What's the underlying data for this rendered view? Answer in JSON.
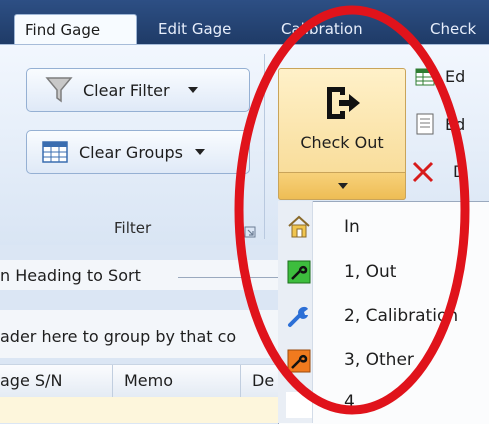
{
  "tabs": [
    {
      "label": "Find Gage",
      "active": true
    },
    {
      "label": "Edit Gage"
    },
    {
      "label": "Calibration"
    },
    {
      "label": "Check"
    }
  ],
  "filter_group": {
    "clear_filter": "Clear Filter",
    "clear_groups": "Clear Groups",
    "label": "Filter"
  },
  "checkout": {
    "label": "Check Out",
    "menu": [
      {
        "label": "In",
        "icon": "house-icon"
      },
      {
        "label": "1, Out",
        "icon": "out-green-icon"
      },
      {
        "label": "2, Calibration",
        "icon": "wrench-icon"
      },
      {
        "label": "3, Other",
        "icon": "out-orange-icon"
      },
      {
        "label": "4",
        "icon": "blank-icon"
      }
    ]
  },
  "right_items": [
    {
      "label": "Ed"
    },
    {
      "label": "Ed"
    },
    {
      "label": "D"
    }
  ],
  "grid": {
    "sort_hint": "n Heading to Sort",
    "group_hint": "ader here to group by that co",
    "columns": [
      "age S/N",
      "Memo",
      "De"
    ]
  },
  "colors": {
    "annotation_circle": "#e0131b",
    "tab_strip": "#2d4f84",
    "checkout_highlight": "#f7d88f"
  }
}
